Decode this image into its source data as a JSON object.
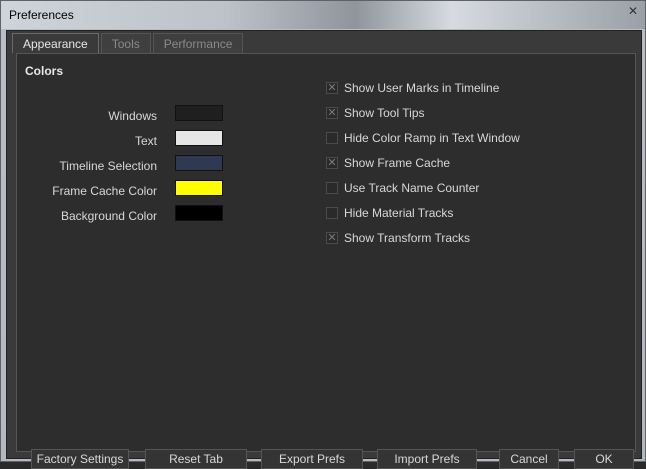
{
  "window": {
    "title": "Preferences",
    "close_glyph": "✕"
  },
  "tabs": [
    {
      "label": "Appearance",
      "active": true
    },
    {
      "label": "Tools",
      "active": false
    },
    {
      "label": "Performance",
      "active": false
    }
  ],
  "colors": {
    "heading": "Colors",
    "items": [
      {
        "label": "Windows",
        "color": "#1f1f1f"
      },
      {
        "label": "Text",
        "color": "#e6e6e6"
      },
      {
        "label": "Timeline Selection",
        "color": "#2f3a52"
      },
      {
        "label": "Frame Cache Color",
        "color": "#ffff00"
      },
      {
        "label": "Background Color",
        "color": "#000000"
      }
    ]
  },
  "options": [
    {
      "label": "Show User Marks in Timeline",
      "checked": true
    },
    {
      "label": "Show Tool Tips",
      "checked": true
    },
    {
      "label": "Hide Color Ramp in Text Window",
      "checked": false
    },
    {
      "label": "Show Frame Cache",
      "checked": true
    },
    {
      "label": "Use Track Name Counter",
      "checked": false
    },
    {
      "label": "Hide Material Tracks",
      "checked": false
    },
    {
      "label": "Show Transform Tracks",
      "checked": true
    }
  ],
  "buttons": {
    "factory_settings": "Factory Settings",
    "reset_tab": "Reset Tab",
    "export_prefs": "Export Prefs",
    "import_prefs": "Import Prefs",
    "cancel": "Cancel",
    "ok": "OK"
  }
}
